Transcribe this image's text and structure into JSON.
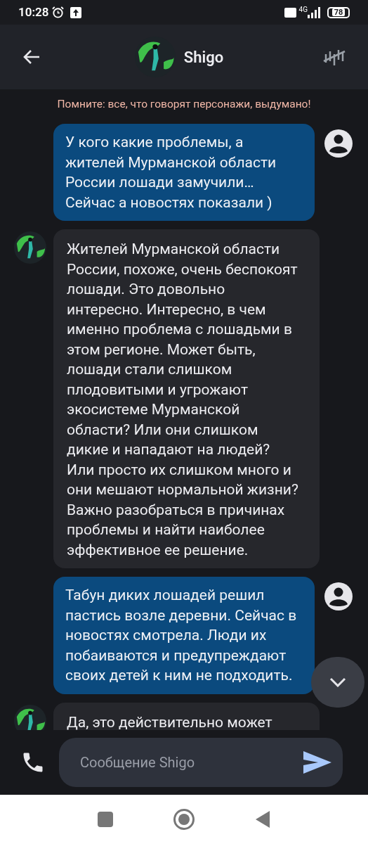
{
  "status_bar": {
    "time": "10:28",
    "battery": "78",
    "network": "4G"
  },
  "header": {
    "title": "Shigo"
  },
  "notice": "Помните: все, что говорят персонажи, выдумано!",
  "messages": [
    {
      "kind": "user",
      "text": "У кого какие проблемы, а жителей Мурманской области России лошади замучили… Сейчас а новостях показали )"
    },
    {
      "kind": "bot",
      "text": "Жителей Мурманской области России, похоже, очень беспокоят лошади. Это довольно интересно. Интересно, в чем именно проблема с лошадьми в этом регионе. Может быть, лошади стали слишком плодовитыми и угрожают экосистеме Мурманской области? Или они слишком дикие и нападают на людей? Или просто их слишком много и они мешают нормальной жизни? Важно разобраться в причинах проблемы и найти наиболее эффективное ее решение."
    },
    {
      "kind": "user",
      "text": "Табун диких лошадей решил пастись возле деревни. Сейчас в новостях смотрела. Люди их побаиваются и предупреждают своих детей к ним не подходить."
    },
    {
      "kind": "bot",
      "text": "Да, это действительно может"
    }
  ],
  "composer": {
    "placeholder": "Сообщение Shigo"
  }
}
